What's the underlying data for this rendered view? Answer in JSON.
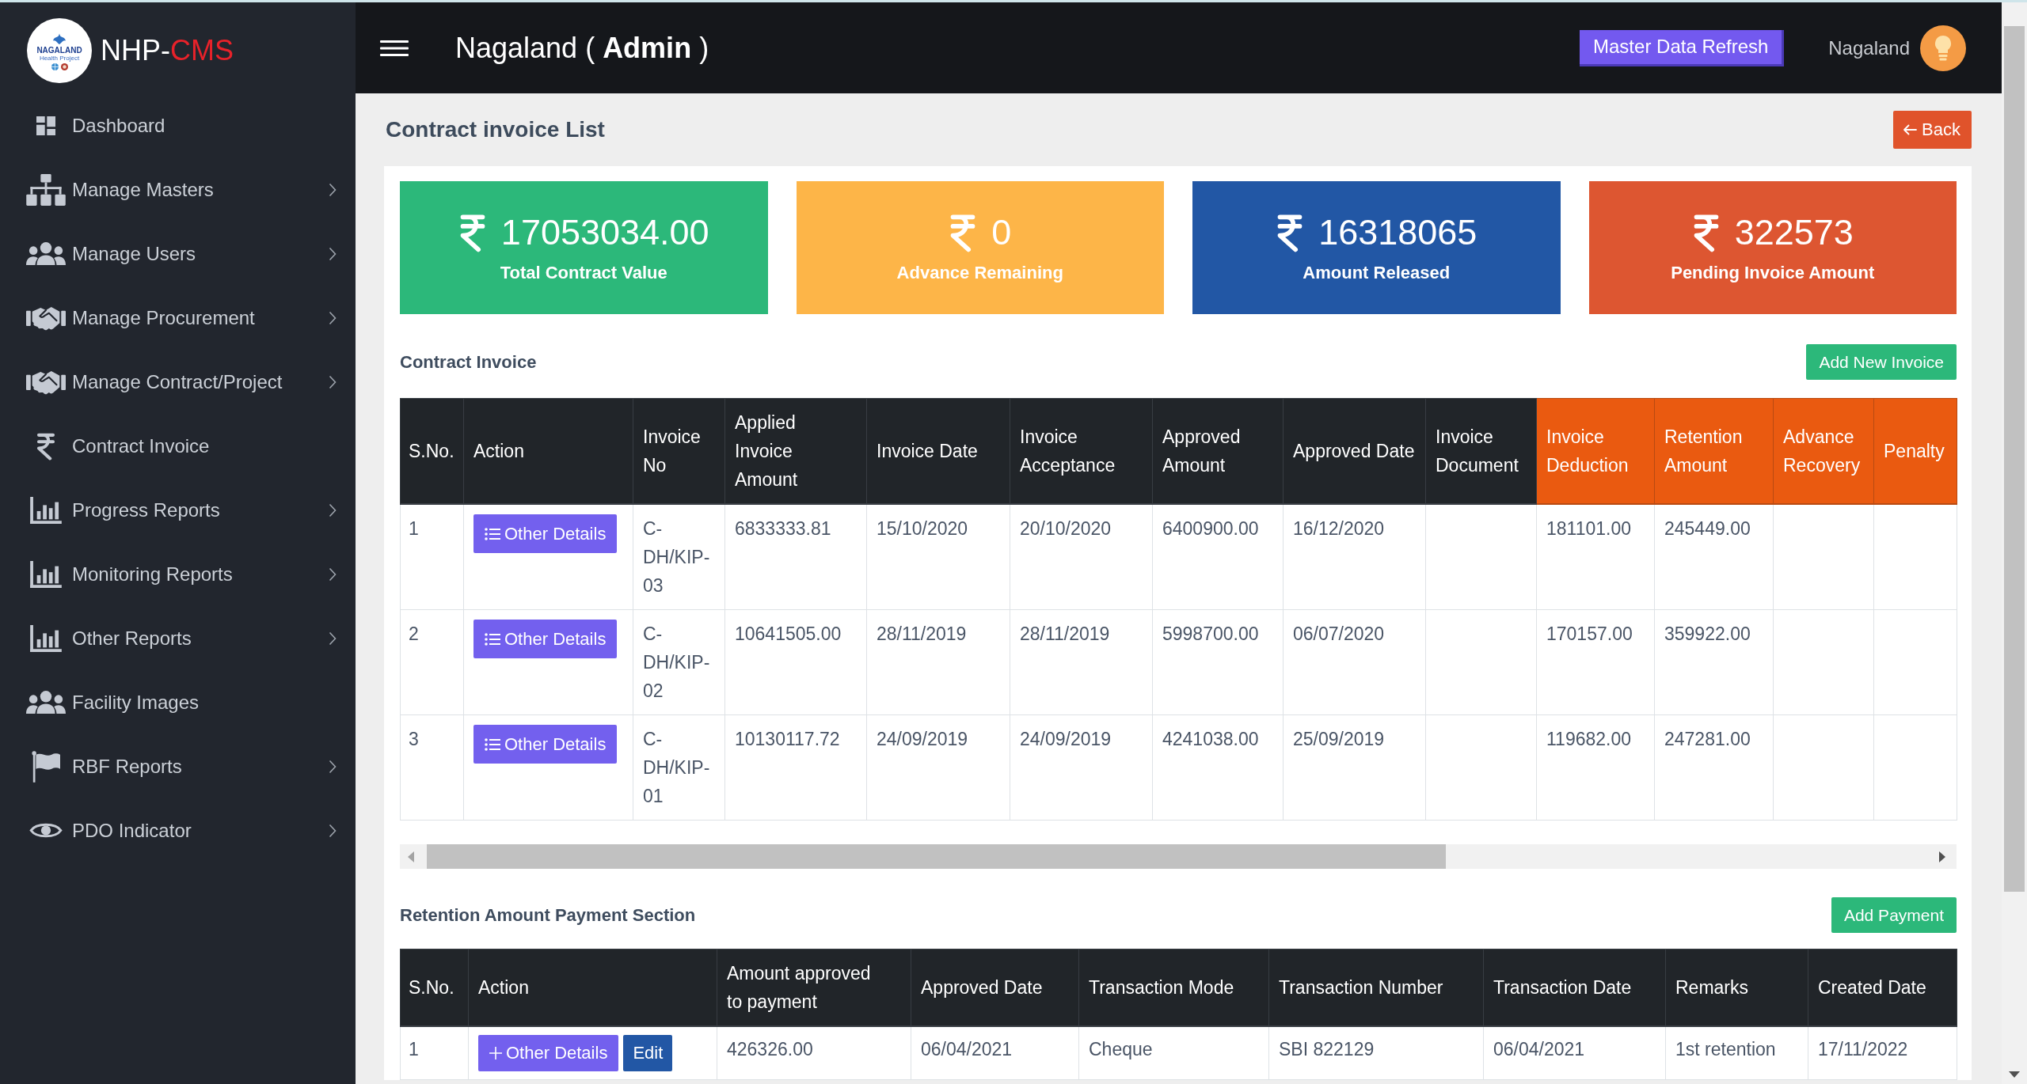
{
  "sidebar": {
    "brand": {
      "logo_title": "NAGALAND",
      "logo_subtitle": "Health Project",
      "name": "NHP-",
      "name_accent": "CMS"
    },
    "items": [
      {
        "label": "Dashboard",
        "has_submenu": false,
        "selected": false
      },
      {
        "label": "Manage Masters",
        "has_submenu": true,
        "selected": false
      },
      {
        "label": "Manage Users",
        "has_submenu": true,
        "selected": false
      },
      {
        "label": "Manage Procurement",
        "has_submenu": true,
        "selected": false
      },
      {
        "label": "Manage Contract/Project",
        "has_submenu": true,
        "selected": false
      },
      {
        "label": "Contract Invoice",
        "has_submenu": false,
        "selected": false
      },
      {
        "label": "Progress Reports",
        "has_submenu": true,
        "selected": false
      },
      {
        "label": "Monitoring Reports",
        "has_submenu": true,
        "selected": false
      },
      {
        "label": "Other Reports",
        "has_submenu": true,
        "selected": false
      },
      {
        "label": "Facility Images",
        "has_submenu": false,
        "selected": false
      },
      {
        "label": "RBF Reports",
        "has_submenu": true,
        "selected": false
      },
      {
        "label": "PDO Indicator",
        "has_submenu": true,
        "selected": false
      }
    ]
  },
  "header": {
    "title": "Nagaland ( **Admin** )",
    "refresh_button": "Master Data Refresh",
    "user_name": "Nagaland"
  },
  "page": {
    "title": "Contract invoice List",
    "back_button": "Back"
  },
  "summary_cards": [
    {
      "amount": "17053034.00",
      "label": "Total Contract Value",
      "color": "#2cb87a"
    },
    {
      "amount": "0",
      "label": "Advance Remaining",
      "color": "#fdb548"
    },
    {
      "amount": "16318065",
      "label": "Amount Released",
      "color": "#2257a5"
    },
    {
      "amount": "322573",
      "label": "Pending Invoice Amount",
      "color": "#dd5631"
    }
  ],
  "contract_invoice": {
    "title": "Contract Invoice",
    "add_button": "Add New Invoice",
    "columns": [
      {
        "label": "S.No.",
        "highlighted": false
      },
      {
        "label": "Action",
        "highlighted": false
      },
      {
        "label": "Invoice No",
        "highlighted": false
      },
      {
        "label": "Applied Invoice Amount",
        "highlighted": false
      },
      {
        "label": "Invoice Date",
        "highlighted": false
      },
      {
        "label": "Invoice Acceptance",
        "highlighted": false
      },
      {
        "label": "Approved Amount",
        "highlighted": false
      },
      {
        "label": "Approved Date",
        "highlighted": false
      },
      {
        "label": "Invoice Document",
        "highlighted": false
      },
      {
        "label": "Invoice Deduction",
        "highlighted": true
      },
      {
        "label": "Retention Amount",
        "highlighted": true
      },
      {
        "label": "Advance Recovery",
        "highlighted": true
      },
      {
        "label": "Penalty",
        "highlighted": true
      }
    ],
    "rows": [
      {
        "s_no": "1",
        "action": "Other Details",
        "invoice_no": "C-DH/KIP-03",
        "applied_invoice_amount": "6833333.81",
        "invoice_date": "15/10/2020",
        "invoice_acceptance": "20/10/2020",
        "approved_amount": "6400900.00",
        "approved_date": "16/12/2020",
        "invoice_deduction": "181101.00",
        "retention_amount": "245449.00"
      },
      {
        "s_no": "2",
        "action": "Other Details",
        "invoice_no": "C-DH/KIP-02",
        "applied_invoice_amount": "10641505.00",
        "invoice_date": "28/11/2019",
        "invoice_acceptance": "28/11/2019",
        "approved_amount": "5998700.00",
        "approved_date": "06/07/2020",
        "invoice_deduction": "170157.00",
        "retention_amount": "359922.00"
      },
      {
        "s_no": "3",
        "action": "Other Details",
        "invoice_no": "C-DH/KIP-01",
        "applied_invoice_amount": "10130117.72",
        "invoice_date": "24/09/2019",
        "invoice_acceptance": "24/09/2019",
        "approved_amount": "4241038.00",
        "approved_date": "25/09/2019",
        "invoice_deduction": "119682.00",
        "retention_amount": "247281.00"
      }
    ]
  },
  "retention_payment": {
    "title": "Retention Amount Payment Section",
    "add_button": "Add Payment",
    "columns": [
      "S.No.",
      "Action",
      "Amount approved to payment",
      "Approved Date",
      "Transaction Mode",
      "Transaction Number",
      "Transaction Date",
      "Remarks",
      "Created Date"
    ],
    "rows": [
      {
        "s_no": "1",
        "actions": [
          {
            "label": "Other Details",
            "kind": "details"
          },
          {
            "label": "Edit",
            "kind": "edit"
          }
        ],
        "amount_approved": "426326.00",
        "approved_date": "06/04/2021",
        "transaction_mode": "Cheque",
        "transaction_number": "SBI 822129",
        "transaction_date": "06/04/2021",
        "remarks": "1st retention",
        "created_date": "17/11/2022"
      }
    ]
  }
}
